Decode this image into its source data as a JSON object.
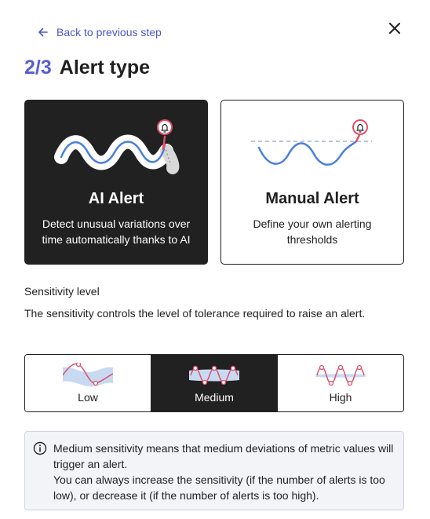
{
  "nav": {
    "back_label": "Back to previous step",
    "back_icon": "arrow-left-icon",
    "close_icon": "close-icon"
  },
  "header": {
    "step": "2/3",
    "title": "Alert type"
  },
  "alert_types": [
    {
      "title": "AI Alert",
      "description": "Detect unusual variations over time automatically thanks to AI",
      "selected": true
    },
    {
      "title": "Manual Alert",
      "description": "Define your own alerting thresholds",
      "selected": false
    }
  ],
  "sensitivity": {
    "label": "Sensitivity level",
    "description": "The sensitivity controls the level of tolerance required to raise an alert.",
    "options": [
      "Low",
      "Medium",
      "High"
    ],
    "selected": "Medium"
  },
  "info": {
    "icon": "info-icon",
    "text": "Medium sensitivity means that medium deviations of metric values will trigger an alert.",
    "text2": "You can always increase the sensitivity (if the number of alerts is too low), or decrease it (if the number of alerts is too high)."
  },
  "colors": {
    "accent": "#4a58c8",
    "dark": "#212121",
    "line_blue": "#4a7fe0",
    "alert_red": "#e0506a",
    "info_bg": "#f3f4f8"
  }
}
